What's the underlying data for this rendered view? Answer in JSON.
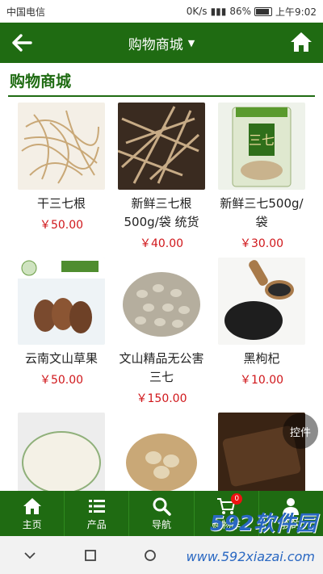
{
  "status_bar": {
    "carrier": "中国电信",
    "speed": "0K/s",
    "battery": "86%",
    "time": "上午9:02"
  },
  "header": {
    "title": "购物商城"
  },
  "section": {
    "title": "购物商城"
  },
  "products": [
    {
      "name": "干三七根",
      "price": "￥50.00"
    },
    {
      "name": "新鲜三七根500g/袋 统货",
      "price": "￥40.00"
    },
    {
      "name": "新鲜三七500g/袋",
      "price": "￥30.00"
    },
    {
      "name": "云南文山草果",
      "price": "￥50.00"
    },
    {
      "name": "文山精品无公害三七",
      "price": "￥150.00"
    },
    {
      "name": "黑枸杞",
      "price": "￥10.00"
    }
  ],
  "float_button": "控件",
  "tabs": [
    {
      "label": "主页",
      "icon": "home-icon"
    },
    {
      "label": "产品",
      "icon": "list-icon"
    },
    {
      "label": "导航",
      "icon": "search-icon"
    },
    {
      "label": "购物车",
      "icon": "cart-icon",
      "badge": "0"
    },
    {
      "label": "我的",
      "icon": "user-icon"
    }
  ],
  "watermark": {
    "brand": "592软件园",
    "url": "www.592xiazai.com"
  },
  "colors": {
    "primary": "#1f6b12",
    "price": "#d0171b"
  }
}
